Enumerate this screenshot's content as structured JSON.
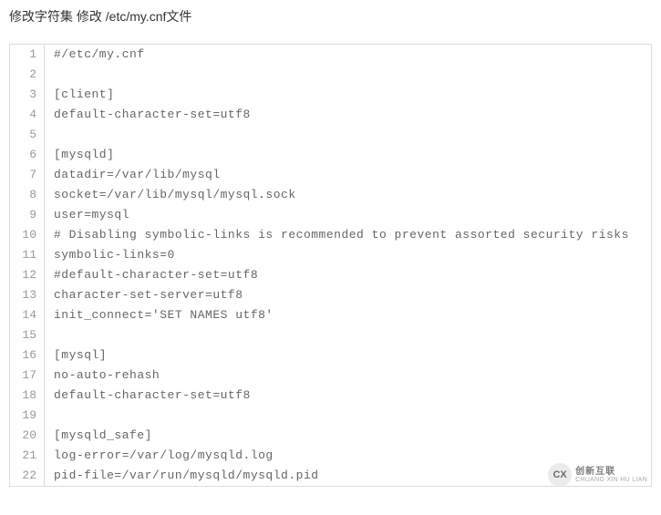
{
  "heading": "修改字符集 修改 /etc/my.cnf文件",
  "code_lines": [
    "#/etc/my.cnf",
    "",
    "[client]",
    "default-character-set=utf8",
    "",
    "[mysqld]",
    "datadir=/var/lib/mysql",
    "socket=/var/lib/mysql/mysql.sock",
    "user=mysql",
    "# Disabling symbolic-links is recommended to prevent assorted security risks",
    "symbolic-links=0",
    "#default-character-set=utf8",
    "character-set-server=utf8",
    "init_connect='SET NAMES utf8'",
    "",
    "[mysql]",
    "no-auto-rehash",
    "default-character-set=utf8",
    "",
    "[mysqld_safe]",
    "log-error=/var/log/mysqld.log",
    "pid-file=/var/run/mysqld/mysqld.pid"
  ],
  "watermark": {
    "logo_text": "CX",
    "name_cn": "创新互联",
    "name_en": "CHUANG XIN HU LIAN"
  }
}
